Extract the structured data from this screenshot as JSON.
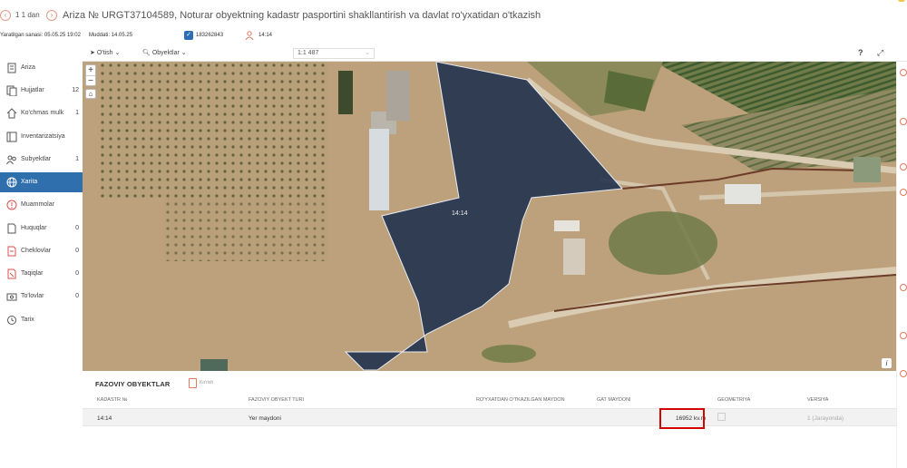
{
  "header": {
    "counter": "1 1 dan",
    "title": "Ariza № URGT37104589, Noturar obyektning kadastr pasportini shakllantirish va davlat ro'yxatidan o'tkazish"
  },
  "meta": {
    "created": "Yaratilgan sanasi: 05.05.25 19:02",
    "deadline": "Muddati: 14.05.25",
    "id": "183262843",
    "cadastre": "14:14"
  },
  "sidebar": {
    "items": [
      {
        "label": "Ariza",
        "count": "",
        "icon": "document-icon"
      },
      {
        "label": "Hujjatlar",
        "count": "12",
        "icon": "files-icon"
      },
      {
        "label": "Ko'chmas mulk",
        "count": "1",
        "icon": "home-icon"
      },
      {
        "label": "Inventarizatsiya",
        "count": "",
        "icon": "inventory-icon"
      },
      {
        "label": "Subyektlar",
        "count": "1",
        "icon": "people-icon"
      },
      {
        "label": "Xarita",
        "count": "",
        "icon": "globe-icon"
      },
      {
        "label": "Muammolar",
        "count": "",
        "icon": "alert-icon"
      },
      {
        "label": "Huquqlar",
        "count": "0",
        "icon": "rights-icon"
      },
      {
        "label": "Cheklovlar",
        "count": "0",
        "icon": "restrictions-icon"
      },
      {
        "label": "Taqiqlar",
        "count": "0",
        "icon": "bans-icon"
      },
      {
        "label": "To'lovlar",
        "count": "0",
        "icon": "payments-icon"
      },
      {
        "label": "Tarix",
        "count": "",
        "icon": "history-icon"
      }
    ]
  },
  "map_toolbar": {
    "goto": "O'tish",
    "objects": "Obyektlar",
    "scale": "1:1 487",
    "help": "?"
  },
  "map": {
    "parcel_label": "14:14",
    "parcel_color": "#1e2f4d"
  },
  "objects_panel": {
    "title": "FAZOVIY OBYEKTLAR",
    "pdf_label": "Ko'rish",
    "columns": [
      "KADASTR №",
      "FAZOVIY OBYEKT TURI",
      "RO'YXATDAN O'TKAZILGAN MAYDON",
      "GAT MAYDONI",
      "GEOMETRIYA",
      "VERSIYA"
    ],
    "rows": [
      {
        "cadastre": "14:14",
        "type": "Yer maydoni",
        "registered_area": "",
        "gat_area": "16952 kv.m",
        "version": "1 (Jarayonda)"
      }
    ]
  },
  "colors": {
    "accent": "#2f6fad",
    "highlight": "#d20000",
    "nav": "#e07a5f"
  }
}
